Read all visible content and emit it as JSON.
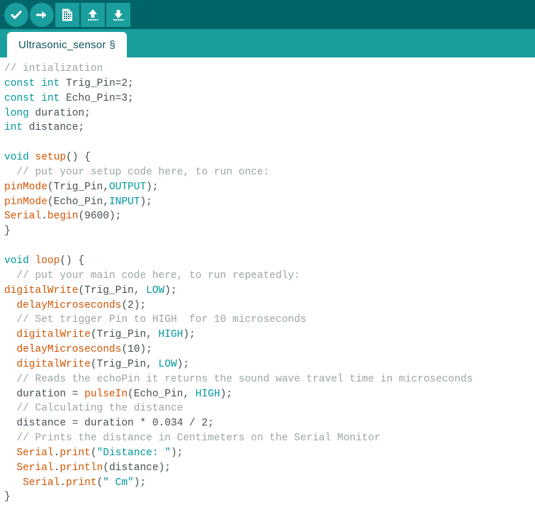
{
  "toolbar": {
    "buttons": [
      {
        "name": "verify-button",
        "label": "Verify",
        "icon": "check-circle-icon"
      },
      {
        "name": "upload-button",
        "label": "Upload",
        "icon": "arrow-right-circle-icon"
      },
      {
        "name": "new-button",
        "label": "New",
        "icon": "new-document-icon"
      },
      {
        "name": "open-button",
        "label": "Open",
        "icon": "arrow-up-icon"
      },
      {
        "name": "save-button",
        "label": "Save",
        "icon": "arrow-down-icon"
      }
    ]
  },
  "tabbar": {
    "active_tab": "Ultrasonic_sensor",
    "section_mark": "§"
  },
  "colors": {
    "toolbar_bg": "#006468",
    "tabbar_bg": "#1a9e9e",
    "tab_active_bg": "#ffffff",
    "editor_bg": "#ffffff",
    "comment": "#9aa5a8",
    "keyword": "#00979c",
    "function": "#d35400",
    "identifier": "#434f54"
  },
  "editor": {
    "lines": [
      [
        {
          "t": "comment",
          "s": "// intialization"
        }
      ],
      [
        {
          "t": "keyword",
          "s": "const int"
        },
        {
          "t": "id",
          "s": " Trig_Pin=2;"
        }
      ],
      [
        {
          "t": "keyword",
          "s": "const int"
        },
        {
          "t": "id",
          "s": " Echo_Pin=3;"
        }
      ],
      [
        {
          "t": "keyword",
          "s": "long"
        },
        {
          "t": "id",
          "s": " duration;"
        }
      ],
      [
        {
          "t": "keyword",
          "s": "int"
        },
        {
          "t": "id",
          "s": " distance;"
        }
      ],
      [],
      [
        {
          "t": "keyword",
          "s": "void "
        },
        {
          "t": "fn",
          "s": "setup"
        },
        {
          "t": "id",
          "s": "() {"
        }
      ],
      [
        {
          "t": "comment",
          "s": "  // put your setup code here, to run once:"
        }
      ],
      [
        {
          "t": "fn",
          "s": "pinMode"
        },
        {
          "t": "id",
          "s": "(Trig_Pin,"
        },
        {
          "t": "keyword",
          "s": "OUTPUT"
        },
        {
          "t": "id",
          "s": ");"
        }
      ],
      [
        {
          "t": "fn",
          "s": "pinMode"
        },
        {
          "t": "id",
          "s": "(Echo_Pin,"
        },
        {
          "t": "keyword",
          "s": "INPUT"
        },
        {
          "t": "id",
          "s": ");"
        }
      ],
      [
        {
          "t": "fn",
          "s": "Serial"
        },
        {
          "t": "id",
          "s": "."
        },
        {
          "t": "fn",
          "s": "begin"
        },
        {
          "t": "id",
          "s": "(9600);"
        }
      ],
      [
        {
          "t": "id",
          "s": "}"
        }
      ],
      [],
      [
        {
          "t": "keyword",
          "s": "void "
        },
        {
          "t": "fn",
          "s": "loop"
        },
        {
          "t": "id",
          "s": "() {"
        }
      ],
      [
        {
          "t": "comment",
          "s": "  // put your main code here, to run repeatedly:"
        }
      ],
      [
        {
          "t": "fn",
          "s": "digitalWrite"
        },
        {
          "t": "id",
          "s": "(Trig_Pin, "
        },
        {
          "t": "keyword",
          "s": "LOW"
        },
        {
          "t": "id",
          "s": ");"
        }
      ],
      [
        {
          "t": "id",
          "s": "  "
        },
        {
          "t": "fn",
          "s": "delayMicroseconds"
        },
        {
          "t": "id",
          "s": "(2);"
        }
      ],
      [
        {
          "t": "comment",
          "s": "  // Set trigger Pin to HIGH  for 10 microseconds"
        }
      ],
      [
        {
          "t": "id",
          "s": "  "
        },
        {
          "t": "fn",
          "s": "digitalWrite"
        },
        {
          "t": "id",
          "s": "(Trig_Pin, "
        },
        {
          "t": "keyword",
          "s": "HIGH"
        },
        {
          "t": "id",
          "s": ");"
        }
      ],
      [
        {
          "t": "id",
          "s": "  "
        },
        {
          "t": "fn",
          "s": "delayMicroseconds"
        },
        {
          "t": "id",
          "s": "(10);"
        }
      ],
      [
        {
          "t": "id",
          "s": "  "
        },
        {
          "t": "fn",
          "s": "digitalWrite"
        },
        {
          "t": "id",
          "s": "(Trig_Pin, "
        },
        {
          "t": "keyword",
          "s": "LOW"
        },
        {
          "t": "id",
          "s": ");"
        }
      ],
      [
        {
          "t": "comment",
          "s": "  // Reads the echoPin it returns the sound wave travel time in microseconds"
        }
      ],
      [
        {
          "t": "id",
          "s": "  duration = "
        },
        {
          "t": "fn",
          "s": "pulseIn"
        },
        {
          "t": "id",
          "s": "(Echo_Pin, "
        },
        {
          "t": "keyword",
          "s": "HIGH"
        },
        {
          "t": "id",
          "s": ");"
        }
      ],
      [
        {
          "t": "comment",
          "s": "  // Calculating the distance"
        }
      ],
      [
        {
          "t": "id",
          "s": "  distance = duration * 0.034 / 2;"
        }
      ],
      [
        {
          "t": "comment",
          "s": "  // Prints the distance in Centimeters on the Serial Monitor"
        }
      ],
      [
        {
          "t": "id",
          "s": "  "
        },
        {
          "t": "fn",
          "s": "Serial"
        },
        {
          "t": "id",
          "s": "."
        },
        {
          "t": "fn",
          "s": "print"
        },
        {
          "t": "id",
          "s": "("
        },
        {
          "t": "keyword",
          "s": "\"Distance: \""
        },
        {
          "t": "id",
          "s": ");"
        }
      ],
      [
        {
          "t": "id",
          "s": "  "
        },
        {
          "t": "fn",
          "s": "Serial"
        },
        {
          "t": "id",
          "s": "."
        },
        {
          "t": "fn",
          "s": "println"
        },
        {
          "t": "id",
          "s": "(distance);"
        }
      ],
      [
        {
          "t": "id",
          "s": "   "
        },
        {
          "t": "fn",
          "s": "Serial"
        },
        {
          "t": "id",
          "s": "."
        },
        {
          "t": "fn",
          "s": "print"
        },
        {
          "t": "id",
          "s": "("
        },
        {
          "t": "keyword",
          "s": "\" Cm\""
        },
        {
          "t": "id",
          "s": ");"
        }
      ],
      [
        {
          "t": "id",
          "s": "}"
        }
      ]
    ]
  }
}
